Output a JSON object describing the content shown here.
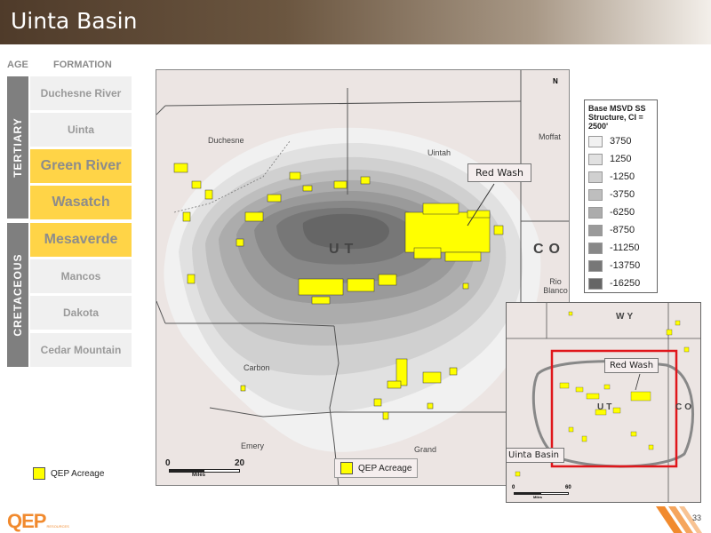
{
  "title": "Uinta Basin",
  "strat": {
    "age_header": "AGE",
    "formation_header": "FORMATION",
    "ages": [
      {
        "label": "TERTIARY"
      },
      {
        "label": "CRETACEOUS"
      }
    ],
    "formations": [
      {
        "name": "Duchesne River",
        "highlighted": false
      },
      {
        "name": "Uinta",
        "highlighted": false
      },
      {
        "name": "Green River",
        "highlighted": true
      },
      {
        "name": "Wasatch",
        "highlighted": true
      },
      {
        "name": "Mesaverde",
        "highlighted": true
      },
      {
        "name": "Mancos",
        "highlighted": false
      },
      {
        "name": "Dakota",
        "highlighted": false
      },
      {
        "name": "Cedar Mountain",
        "highlighted": false
      }
    ]
  },
  "legend_acreage": "QEP Acreage",
  "map": {
    "counties": {
      "duchesne": "Duchesne",
      "uintah": "Uintah",
      "moffat": "Moffat",
      "rio_blanco": "Rio Blanco",
      "carbon": "Carbon",
      "emery": "Emery",
      "grand": "Grand"
    },
    "states": {
      "ut": "UT",
      "co": "CO"
    },
    "callout": "Red Wash",
    "scale": {
      "start": "0",
      "end": "20",
      "unit": "Miles"
    },
    "acreage_label": "QEP Acreage",
    "north": "N"
  },
  "structure_legend": {
    "title": "Base MSVD SS Structure, CI = 2500'",
    "entries": [
      {
        "value": "3750",
        "color": "#f1f1f1"
      },
      {
        "value": "1250",
        "color": "#e1e1e1"
      },
      {
        "value": "-1250",
        "color": "#d0d0d0"
      },
      {
        "value": "-3750",
        "color": "#bebebe"
      },
      {
        "value": "-6250",
        "color": "#acacac"
      },
      {
        "value": "-8750",
        "color": "#9a9a9a"
      },
      {
        "value": "-11250",
        "color": "#888888"
      },
      {
        "value": "-13750",
        "color": "#777777"
      },
      {
        "value": "-16250",
        "color": "#666666"
      }
    ]
  },
  "inset": {
    "wy": "WY",
    "ut": "UT",
    "co": "CO",
    "red_wash": "Red Wash",
    "uinta_basin": "Uinta Basin",
    "scale": {
      "start": "0",
      "end": "60",
      "unit": "Miles"
    }
  },
  "footer": {
    "logo": "QEP",
    "logo_sub": "RESOURCES",
    "page": "33"
  },
  "colors": {
    "acreage": "#ffff00",
    "highlight_formation": "#ffd447",
    "inset_frame": "#e0161b",
    "logo": "#f18a2e"
  }
}
